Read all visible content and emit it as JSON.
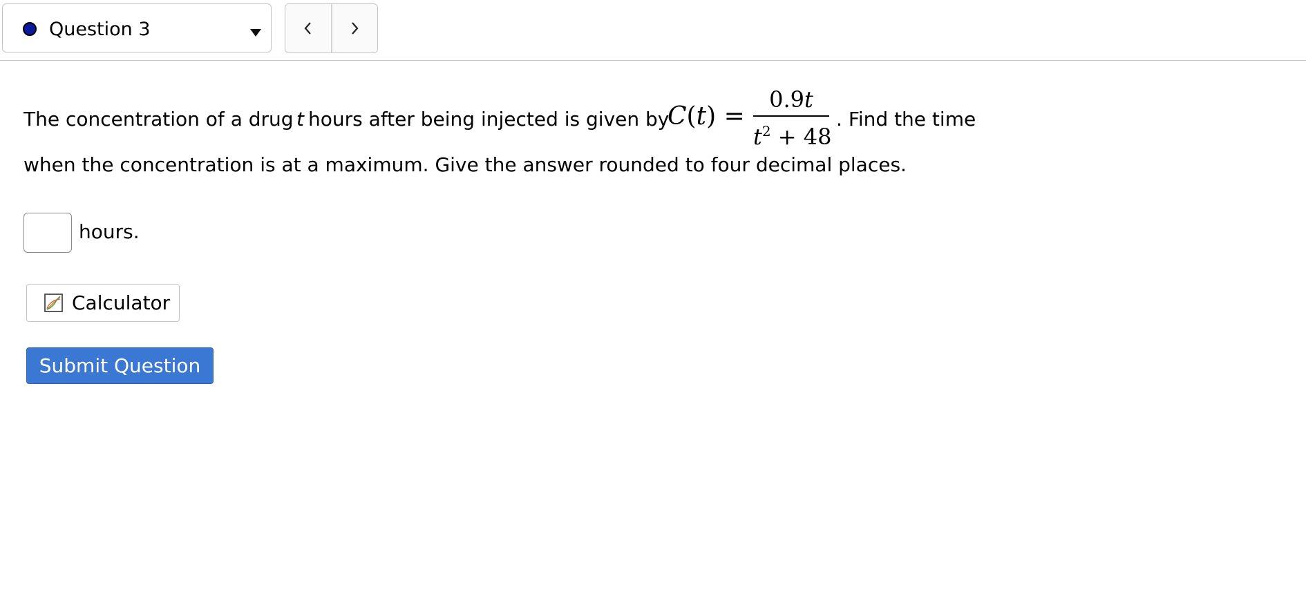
{
  "header": {
    "question_selector": {
      "label": "Question 3",
      "status_color": "#0a1a9e"
    },
    "nav": {
      "prev_icon": "chevron-left-icon",
      "next_icon": "chevron-right-icon"
    }
  },
  "problem": {
    "text_before_var": "The concentration of a drug",
    "variable": "t",
    "text_after_var": "hours after being injected is given by",
    "function_name": "C",
    "function_arg": "t",
    "equals": "=",
    "numerator": "0.9",
    "numerator_var": "t",
    "denominator_var": "t",
    "denominator_exp": "2",
    "denominator_rest": "+ 48",
    "period_after_formula": ".",
    "text_after_formula": "Find the time",
    "line2": "when the concentration is at a maximum. Give the answer rounded to four decimal places."
  },
  "answer": {
    "value": "",
    "unit_label": "hours."
  },
  "buttons": {
    "calculator_label": "Calculator",
    "calculator_icon": "graph-calculator-icon",
    "submit_label": "Submit Question",
    "submit_color": "#3a78d4"
  }
}
